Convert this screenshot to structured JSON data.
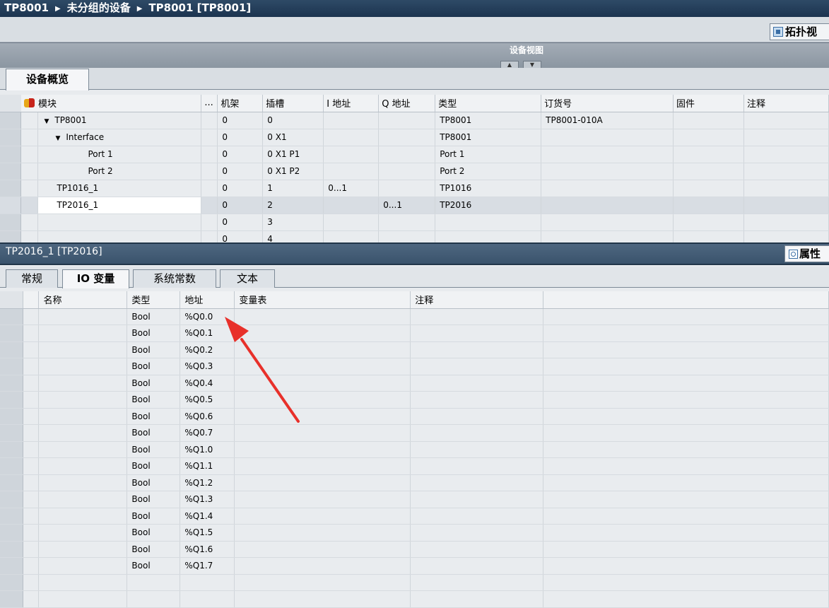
{
  "breadcrumb": [
    "TP8001",
    "未分组的设备",
    "TP8001 [TP8001]"
  ],
  "topology_button": "拓扑视",
  "device_view_label": "设备视图",
  "device_view_arrows": [
    "▲",
    "▼"
  ],
  "overview_tab": "设备概览",
  "device_table": {
    "columns": [
      "模块",
      "...",
      "机架",
      "插槽",
      "I 地址",
      "Q 地址",
      "类型",
      "订货号",
      "固件",
      "注释"
    ],
    "rows": [
      {
        "module": "TP8001",
        "rack": "0",
        "slot": "0",
        "i_addr": "",
        "q_addr": "",
        "type": "TP8001",
        "order": "TP8001-010A",
        "fw": "",
        "comment": ""
      },
      {
        "module": "Interface",
        "rack": "0",
        "slot": "0 X1",
        "i_addr": "",
        "q_addr": "",
        "type": "TP8001",
        "order": "",
        "fw": "",
        "comment": ""
      },
      {
        "module": "Port 1",
        "rack": "0",
        "slot": "0 X1 P1",
        "i_addr": "",
        "q_addr": "",
        "type": "Port 1",
        "order": "",
        "fw": "",
        "comment": ""
      },
      {
        "module": "Port 2",
        "rack": "0",
        "slot": "0 X1 P2",
        "i_addr": "",
        "q_addr": "",
        "type": "Port 2",
        "order": "",
        "fw": "",
        "comment": ""
      },
      {
        "module": "TP1016_1",
        "rack": "0",
        "slot": "1",
        "i_addr": "0...1",
        "q_addr": "",
        "type": "TP1016",
        "order": "",
        "fw": "",
        "comment": ""
      },
      {
        "module": "TP2016_1",
        "rack": "0",
        "slot": "2",
        "i_addr": "",
        "q_addr": "0...1",
        "type": "TP2016",
        "order": "",
        "fw": "",
        "comment": ""
      },
      {
        "module": "",
        "rack": "0",
        "slot": "3",
        "i_addr": "",
        "q_addr": "",
        "type": "",
        "order": "",
        "fw": "",
        "comment": ""
      },
      {
        "module": "",
        "rack": "0",
        "slot": "4",
        "i_addr": "",
        "q_addr": "",
        "type": "",
        "order": "",
        "fw": "",
        "comment": ""
      }
    ]
  },
  "properties": {
    "title": "TP2016_1 [TP2016]",
    "button": "属性",
    "tabs": [
      "常规",
      "IO 变量",
      "系统常数",
      "文本"
    ],
    "active_tab": "IO 变量"
  },
  "io_table": {
    "columns": [
      "名称",
      "类型",
      "地址",
      "变量表",
      "注释"
    ],
    "rows": [
      {
        "name": "",
        "type": "Bool",
        "addr": "%Q0.0"
      },
      {
        "name": "",
        "type": "Bool",
        "addr": "%Q0.1"
      },
      {
        "name": "",
        "type": "Bool",
        "addr": "%Q0.2"
      },
      {
        "name": "",
        "type": "Bool",
        "addr": "%Q0.3"
      },
      {
        "name": "",
        "type": "Bool",
        "addr": "%Q0.4"
      },
      {
        "name": "",
        "type": "Bool",
        "addr": "%Q0.5"
      },
      {
        "name": "",
        "type": "Bool",
        "addr": "%Q0.6"
      },
      {
        "name": "",
        "type": "Bool",
        "addr": "%Q0.7"
      },
      {
        "name": "",
        "type": "Bool",
        "addr": "%Q1.0"
      },
      {
        "name": "",
        "type": "Bool",
        "addr": "%Q1.1"
      },
      {
        "name": "",
        "type": "Bool",
        "addr": "%Q1.2"
      },
      {
        "name": "",
        "type": "Bool",
        "addr": "%Q1.3"
      },
      {
        "name": "",
        "type": "Bool",
        "addr": "%Q1.4"
      },
      {
        "name": "",
        "type": "Bool",
        "addr": "%Q1.5"
      },
      {
        "name": "",
        "type": "Bool",
        "addr": "%Q1.6"
      },
      {
        "name": "",
        "type": "Bool",
        "addr": "%Q1.7"
      },
      {
        "name": "",
        "type": "",
        "addr": ""
      },
      {
        "name": "",
        "type": "",
        "addr": ""
      }
    ]
  },
  "annotation_color": "#e8302a"
}
